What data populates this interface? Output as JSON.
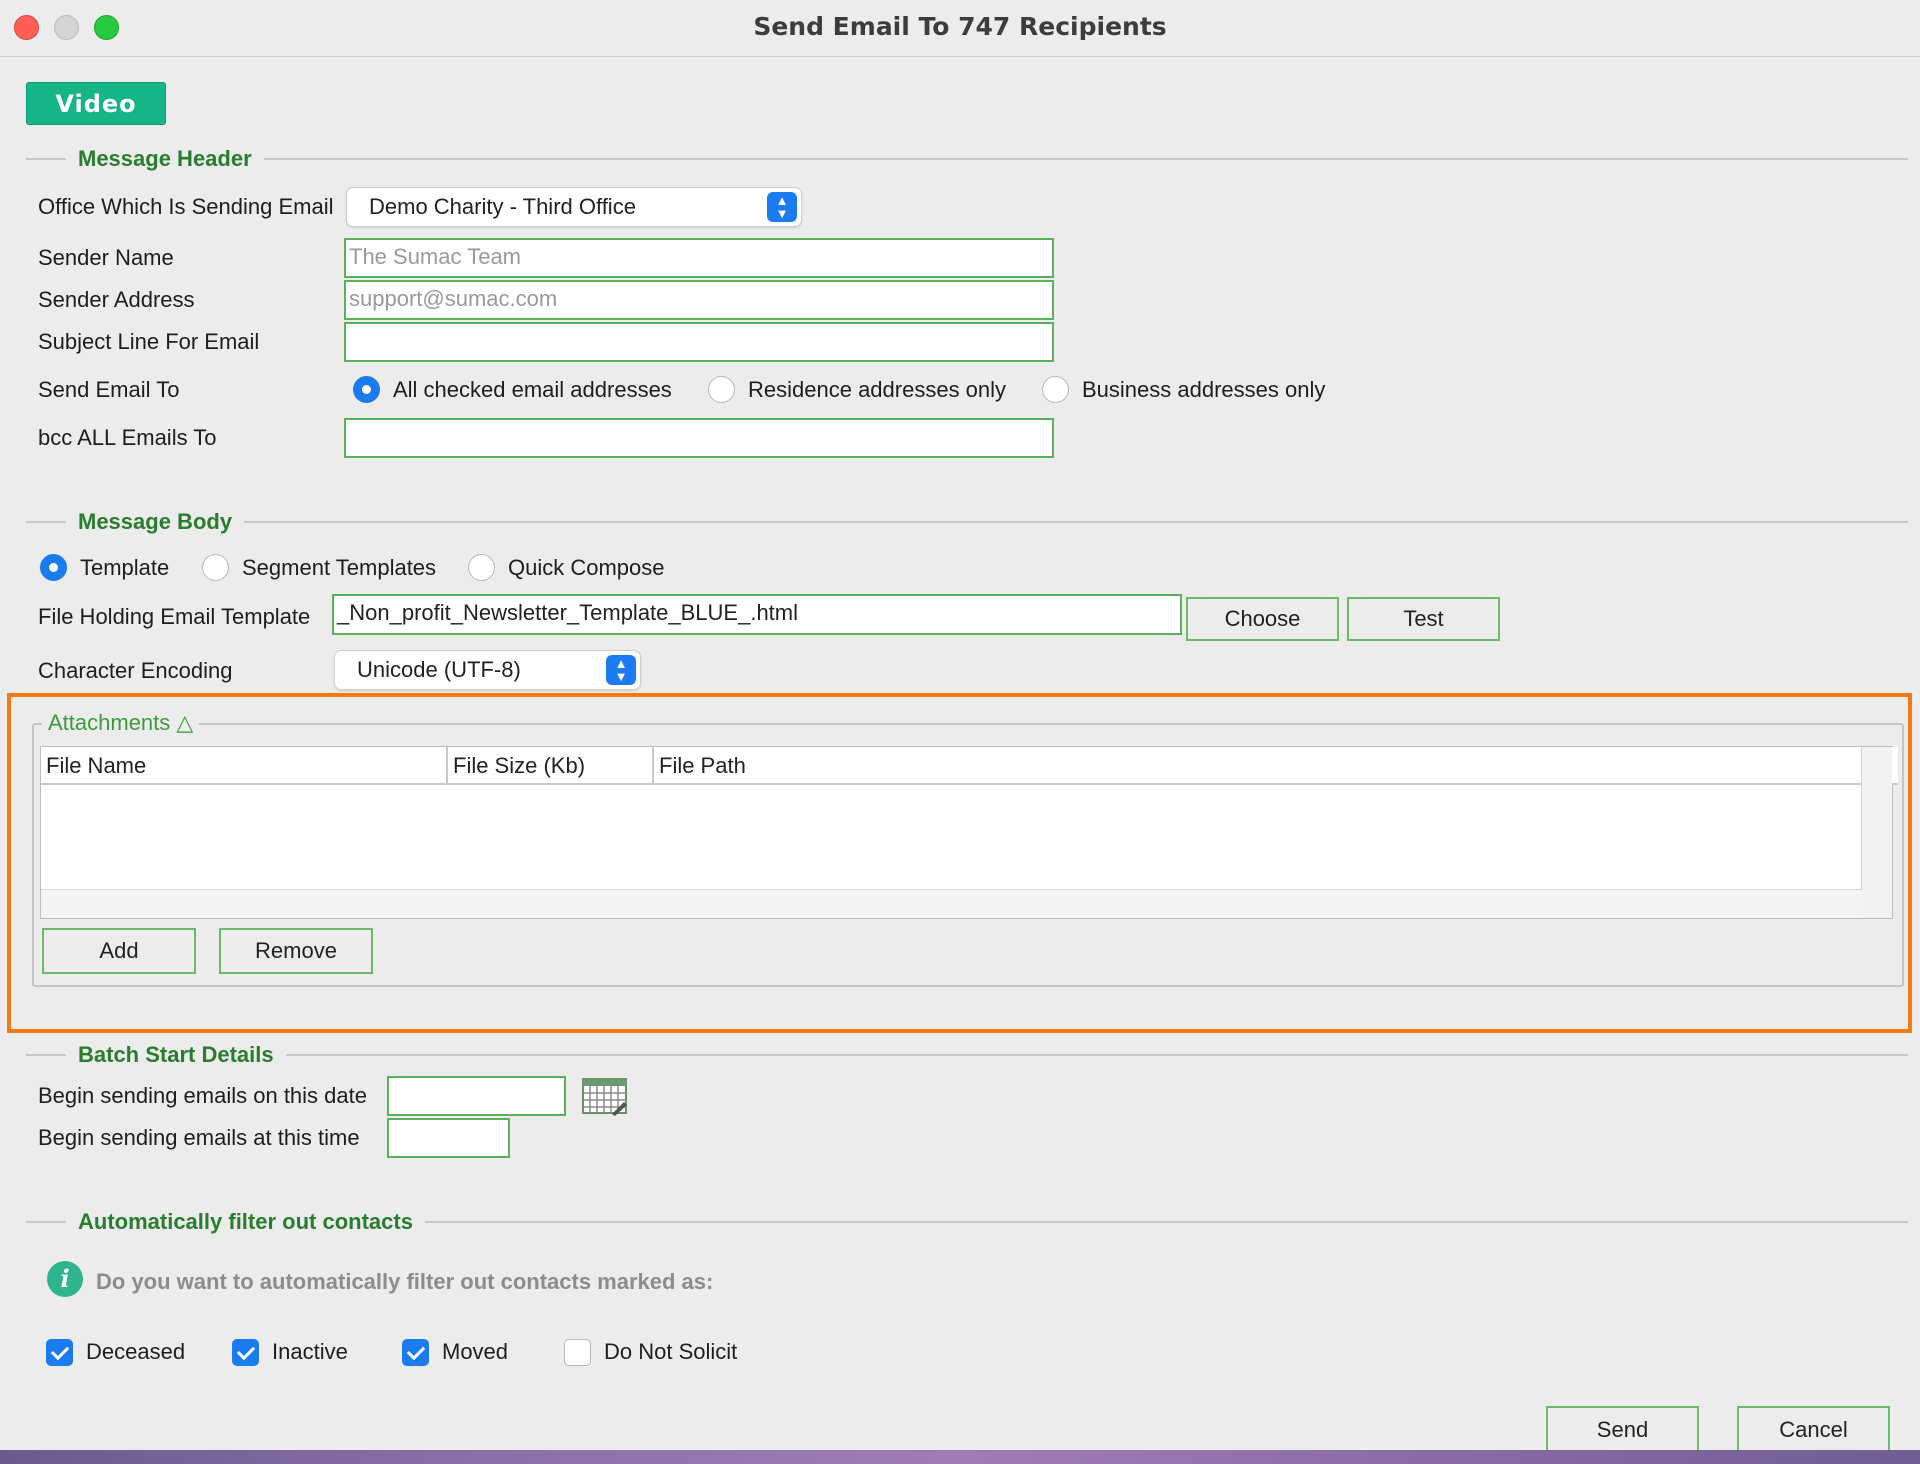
{
  "window": {
    "title": "Send Email To 747 Recipients"
  },
  "video_button": "Video",
  "message_header": {
    "title": "Message Header",
    "office_label": "Office Which Is Sending Email",
    "office_value": "Demo Charity - Third Office",
    "sender_name_label": "Sender Name",
    "sender_name_placeholder": "The Sumac Team",
    "sender_address_label": "Sender Address",
    "sender_address_placeholder": "support@sumac.com",
    "subject_label": "Subject Line For Email",
    "subject_value": "",
    "send_to_label": "Send Email To",
    "send_to_options": [
      {
        "label": "All checked email addresses",
        "selected": true
      },
      {
        "label": "Residence addresses only",
        "selected": false
      },
      {
        "label": "Business addresses only",
        "selected": false
      }
    ],
    "bcc_label": "bcc ALL Emails To",
    "bcc_value": ""
  },
  "message_body": {
    "title": "Message Body",
    "mode_options": [
      {
        "label": "Template",
        "selected": true
      },
      {
        "label": "Segment Templates",
        "selected": false
      },
      {
        "label": "Quick Compose",
        "selected": false
      }
    ],
    "template_file_label": "File Holding Email Template",
    "template_file_value": "_Non_profit_Newsletter_Template_BLUE_.html",
    "choose_button": "Choose",
    "test_button": "Test",
    "encoding_label": "Character Encoding",
    "encoding_value": "Unicode (UTF-8)"
  },
  "attachments": {
    "title": "Attachments △",
    "columns": [
      "File Name",
      "File Size (Kb)",
      "File Path"
    ],
    "rows": [],
    "add_button": "Add",
    "remove_button": "Remove"
  },
  "batch_start": {
    "title": "Batch Start Details",
    "date_label": "Begin sending emails on this date",
    "date_value": "",
    "time_label": "Begin sending emails at this time",
    "time_value": ""
  },
  "filter": {
    "title": "Automatically filter out contacts",
    "info_text": "Do you want to automatically filter out contacts marked as:",
    "options": [
      {
        "label": "Deceased",
        "checked": true
      },
      {
        "label": "Inactive",
        "checked": true
      },
      {
        "label": "Moved",
        "checked": true
      },
      {
        "label": "Do Not Solicit",
        "checked": false
      }
    ]
  },
  "footer": {
    "send_button": "Send",
    "cancel_button": "Cancel"
  },
  "colors": {
    "accent_green": "#2a7d2e",
    "video_green": "#16b586",
    "highlight_orange": "#f47a14",
    "control_blue": "#1a7cf0"
  }
}
